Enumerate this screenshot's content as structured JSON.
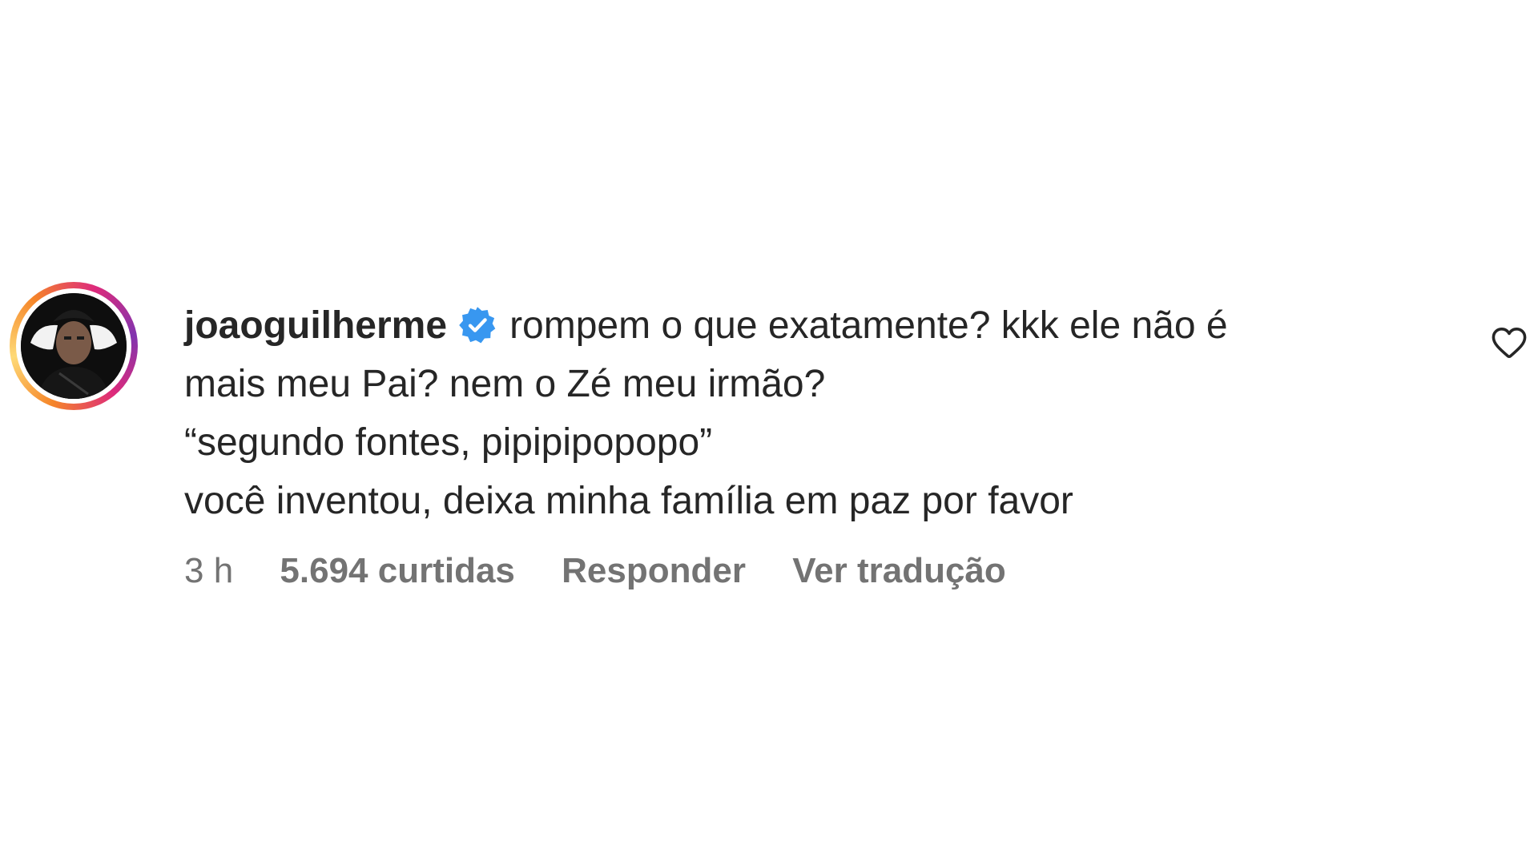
{
  "comment": {
    "username": "joaoguilherme",
    "verified_icon": "verified-badge-icon",
    "lines": [
      "rompem o que exatamente? kkk ele não é",
      "mais meu Pai? nem o Zé meu irmão?",
      "“segundo fontes, pipipipopopo”",
      "você inventou, deixa minha família em paz por favor"
    ],
    "time": "3 h",
    "likes": "5.694 curtidas",
    "reply_label": "Responder",
    "translate_label": "Ver tradução",
    "like_icon": "heart-outline-icon"
  },
  "colors": {
    "text": "#262626",
    "meta": "#737373",
    "verified": "#3897f0"
  }
}
